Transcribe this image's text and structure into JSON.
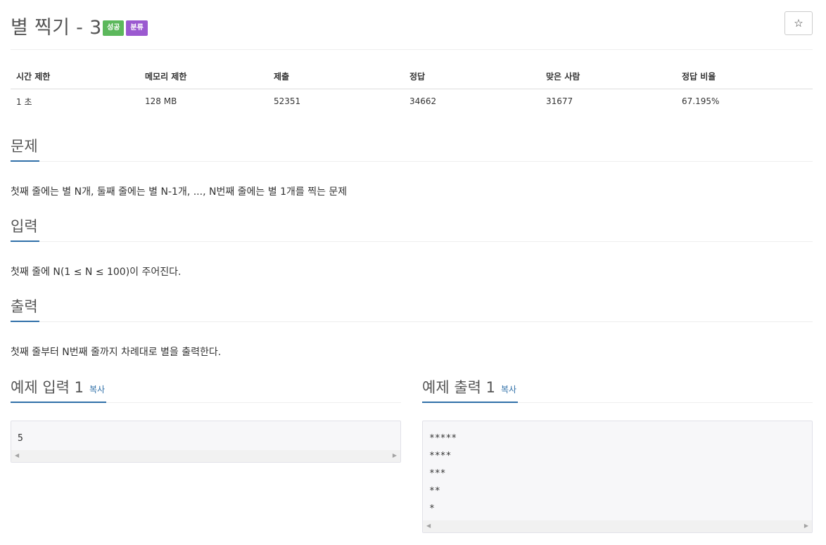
{
  "problem": {
    "title": "별 찍기 - 3",
    "badges": {
      "success": "성공",
      "category": "분류"
    },
    "star_icon": "☆"
  },
  "info_table": {
    "headers": [
      "시간 제한",
      "메모리 제한",
      "제출",
      "정답",
      "맞은 사람",
      "정답 비율"
    ],
    "values": [
      "1 초",
      "128 MB",
      "52351",
      "34662",
      "31677",
      "67.195%"
    ]
  },
  "sections": {
    "problem": {
      "title": "문제",
      "body": "첫째 줄에는 별 N개, 둘째 줄에는 별 N-1개, ..., N번째 줄에는 별 1개를 찍는 문제"
    },
    "input": {
      "title": "입력",
      "body": "첫째 줄에 N(1 ≤ N ≤ 100)이 주어진다."
    },
    "output": {
      "title": "출력",
      "body": "첫째 줄부터 N번째 줄까지 차례대로 별을 출력한다."
    }
  },
  "samples": {
    "input": {
      "title": "예제 입력 1",
      "copy_label": "복사",
      "content": "5"
    },
    "output": {
      "title": "예제 출력 1",
      "copy_label": "복사",
      "content": "*****\n****\n***\n**\n*"
    }
  },
  "icons": {
    "scroll_left": "◀",
    "scroll_right": "▶"
  },
  "colors": {
    "success": "#5cb85c",
    "category": "#9b59d0",
    "accent": "#3070a8"
  }
}
